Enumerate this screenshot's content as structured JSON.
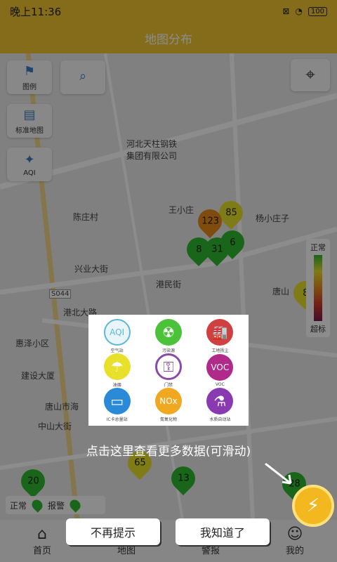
{
  "status_bar": {
    "time": "晚上11:36",
    "battery": "100"
  },
  "header": {
    "title": "地图分布"
  },
  "map_controls": {
    "legend_label": "图例",
    "standard_map_label": "标准地图",
    "aqi_label": "AQI"
  },
  "map_labels": {
    "hebei_steel": "河北天柱钢铁\n集团有限公司",
    "chenzhuang": "陈庄村",
    "wangxiaozhuang": "王小庄",
    "yangxiaozhuangzi": "杨小庄子",
    "xingye": "兴业大街",
    "gangmin": "港民街",
    "tangshan": "唐山",
    "huize": "惠泽小区",
    "jianshe": "建设大厦",
    "tangshanhai": "唐山市海",
    "zhongshan": "中山大街",
    "s044": "S044",
    "gangbei": "港北大路"
  },
  "markers": [
    {
      "value": "85",
      "color": "#e8e02a"
    },
    {
      "value": "123",
      "color": "#e88a1a"
    },
    {
      "value": "6",
      "color": "#2eb82e"
    },
    {
      "value": "8",
      "color": "#2eb82e"
    },
    {
      "value": "31",
      "color": "#2eb82e"
    },
    {
      "value": "20",
      "color": "#2eb82e"
    },
    {
      "value": "65",
      "color": "#e8e02a"
    },
    {
      "value": "13",
      "color": "#2eb82e"
    },
    {
      "value": "8",
      "color": "#e8e02a"
    },
    {
      "value": "28",
      "color": "#2eb82e"
    }
  ],
  "legend": {
    "top": "正常",
    "bottom": "超标"
  },
  "status_legend": {
    "normal": "正常",
    "alarm": "报警"
  },
  "tabs": [
    {
      "label": "首页",
      "icon": "home-icon"
    },
    {
      "label": "地图",
      "icon": "map-icon"
    },
    {
      "label": "警报",
      "icon": "alarm-icon"
    },
    {
      "label": "我的",
      "icon": "user-icon"
    }
  ],
  "popup_items": [
    {
      "title": "AQI",
      "label": "空气站",
      "color": "#5bb8d8",
      "icon": "aqi-icon"
    },
    {
      "title": "☢",
      "label": "污染源",
      "color": "#4cc23a",
      "icon": "radiation-icon"
    },
    {
      "title": "🏭",
      "label": "工地扬尘",
      "color": "#d04040",
      "icon": "factory-icon"
    },
    {
      "title": "☂",
      "label": "油烟",
      "color": "#e8e02a",
      "icon": "smoke-icon"
    },
    {
      "title": "⚿",
      "label": "门禁",
      "color": "#8a4aa8",
      "icon": "key-icon"
    },
    {
      "title": "VOC",
      "label": "VOC",
      "color": "#b02a8a",
      "icon": "voc-icon"
    },
    {
      "title": "▭",
      "label": "IC卡总量站",
      "color": "#2a8ad8",
      "icon": "card-icon"
    },
    {
      "title": "NOx",
      "label": "氮氧化物",
      "color": "#f0a820",
      "icon": "nox-icon"
    },
    {
      "title": "⚗",
      "label": "水质自动站",
      "color": "#8a3ab0",
      "icon": "flask-icon"
    }
  ],
  "overlay": {
    "hint": "点击这里查看更多数据(可滑动)",
    "dismiss_label": "不再提示",
    "ok_label": "我知道了"
  }
}
